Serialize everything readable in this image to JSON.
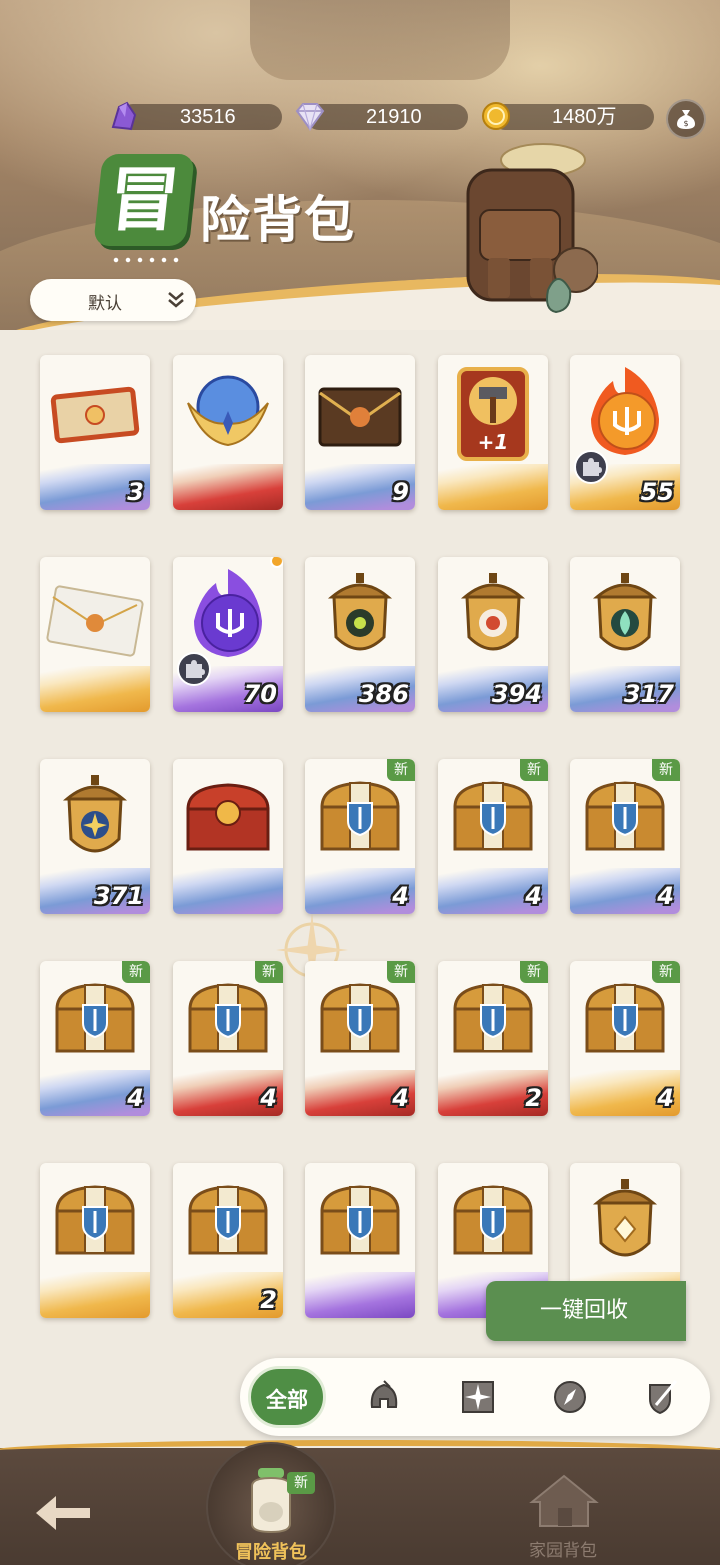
{
  "currencies": [
    {
      "icon": "purple-crystal-icon",
      "value": "33516"
    },
    {
      "icon": "diamond-icon",
      "value": "21910"
    },
    {
      "icon": "gold-coin-icon",
      "value": "1480万"
    }
  ],
  "title": {
    "badge_char": "冒",
    "rest": "险背包"
  },
  "sort": {
    "label": "默认"
  },
  "items": [
    {
      "icon": "ticket-icon",
      "qty": "3",
      "band": "blue",
      "new": false
    },
    {
      "icon": "crystal-orb-icon",
      "qty": "",
      "band": "red",
      "new": false
    },
    {
      "icon": "sealed-envelope-icon",
      "qty": "9",
      "band": "blue",
      "new": false
    },
    {
      "icon": "hammer-card-icon",
      "qty": "",
      "band": "gold",
      "new": false,
      "card_text": "+1"
    },
    {
      "icon": "fire-trident-orb-icon",
      "qty": "55",
      "band": "gold",
      "new": false,
      "puzzle": true
    },
    {
      "icon": "letter-icon",
      "qty": "",
      "band": "gold",
      "new": false
    },
    {
      "icon": "purple-trident-orb-icon",
      "qty": "70",
      "band": "purple",
      "new": false,
      "puzzle": true,
      "dot": true
    },
    {
      "icon": "acorn-eye-icon",
      "qty": "386",
      "band": "blue",
      "new": false
    },
    {
      "icon": "acorn-target-icon",
      "qty": "394",
      "band": "blue",
      "new": false
    },
    {
      "icon": "acorn-leaf-icon",
      "qty": "317",
      "band": "blue",
      "new": false
    },
    {
      "icon": "acorn-star-icon",
      "qty": "371",
      "band": "blue",
      "new": false
    },
    {
      "icon": "red-chest-icon",
      "qty": "",
      "band": "blue",
      "new": false
    },
    {
      "icon": "treasure-chest-icon",
      "qty": "4",
      "band": "blue",
      "new": true
    },
    {
      "icon": "treasure-chest-icon",
      "qty": "4",
      "band": "blue",
      "new": true
    },
    {
      "icon": "treasure-chest-icon",
      "qty": "4",
      "band": "blue",
      "new": true
    },
    {
      "icon": "treasure-chest-icon",
      "qty": "4",
      "band": "blue",
      "new": true
    },
    {
      "icon": "treasure-chest-icon",
      "qty": "4",
      "band": "red",
      "new": true
    },
    {
      "icon": "treasure-chest-icon",
      "qty": "4",
      "band": "red",
      "new": true
    },
    {
      "icon": "treasure-chest-icon",
      "qty": "2",
      "band": "red",
      "new": true
    },
    {
      "icon": "treasure-chest-icon",
      "qty": "4",
      "band": "gold",
      "new": true
    },
    {
      "icon": "treasure-chest-icon",
      "qty": "",
      "band": "gold",
      "new": false
    },
    {
      "icon": "treasure-chest-icon",
      "qty": "2",
      "band": "gold",
      "new": false
    },
    {
      "icon": "treasure-chest-icon",
      "qty": "",
      "band": "purple",
      "new": false
    },
    {
      "icon": "treasure-chest-icon",
      "qty": "",
      "band": "purple",
      "new": false
    },
    {
      "icon": "acorn-diamond-icon",
      "qty": "",
      "band": "gold",
      "new": false
    }
  ],
  "new_label": "新",
  "recycle_label": "一键回收",
  "filters": {
    "all_label": "全部",
    "icons": [
      "helmet-icon",
      "compass-star-icon",
      "compass-icon",
      "sword-shield-icon"
    ]
  },
  "nav": {
    "back_icon": "back-arrow-icon",
    "adventure_label": "冒险背包",
    "adventure_new": "新",
    "home_label": "家园背包"
  },
  "colors": {
    "accent_green": "#5b8f50",
    "gold": "#e0a945",
    "nav_bg": "#4a3b31"
  }
}
